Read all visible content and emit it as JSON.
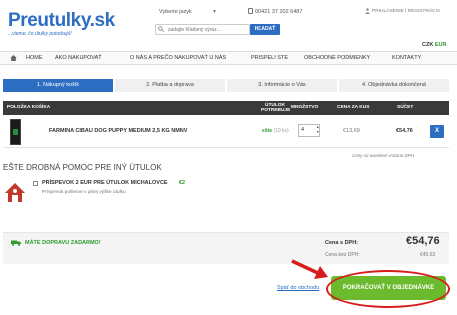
{
  "header": {
    "logo": "Preutulky.sk",
    "tagline": "...vieme, čo útulky potrebujú!",
    "language_label": "Vyberte jazyk",
    "phone": "00421 37 202 6487",
    "account_links": "PRIHLÁSENIE | REGISTRÁCIA",
    "search_placeholder": "zadajte hľadaný výraz...",
    "search_button": "HĽADAŤ",
    "currency_active": "CZK",
    "currency_other": "EUR"
  },
  "nav": {
    "items": [
      "HOME",
      "AKO NAKUPOVAŤ",
      "O NÁS A PREČO NAKUPOVAŤ U NÁS",
      "PRISPELI STE",
      "OBCHODNÉ PODMIENKY",
      "KONTAKTY"
    ]
  },
  "steps": [
    {
      "label": "1. Nákupný košík",
      "active": true
    },
    {
      "label": "2. Platba a doprava",
      "active": false
    },
    {
      "label": "3. Informácie o Vás",
      "active": false
    },
    {
      "label": "4. Objednávka dokončená",
      "active": false
    }
  ],
  "cart": {
    "headers": {
      "item": "POLOŽKA KOŠÍKA",
      "need": "ÚTULOK POTREBUJE",
      "qty": "MNOŽSTVO",
      "unit": "CENA ZA KUS",
      "sum": "SÚČET"
    },
    "rows": [
      {
        "name": "FARMINA CIBAU DOG PUPPY MEDIUM 2,5 KG NMNV",
        "need": "ešte",
        "need_count": "(10 ks)",
        "qty": "4",
        "unit_price": "€13,69",
        "sum": "€54,76",
        "remove": "X"
      }
    ],
    "vat_note": "Ceny sú uvedené vrátane DPH"
  },
  "charity": {
    "title": "EŠTE DROBNÁ POMOC PRE INÝ ÚTULOK",
    "label": "PRÍSPEVOK 2 EUR PRE ÚTULOK MICHALOVCE",
    "price": "€2",
    "description": "Príspevok pošleme v plnej výške útulku"
  },
  "summary": {
    "free_shipping": "MÁTE DOPRAVU ZADARMO!",
    "vat_label": "Cena s DPH:",
    "total_vat": "€54,76",
    "novat_label": "Cena bez DPH:",
    "total_novat": "€45,63"
  },
  "footer": {
    "back_link": "Späť do obchodu",
    "continue_button": "POKRAČOVAŤ V OBJEDNÁVKE"
  },
  "colors": {
    "brand_blue": "#2d6ec2",
    "accent_green": "#6cbb2e",
    "annotation_red": "#d91c1c"
  }
}
